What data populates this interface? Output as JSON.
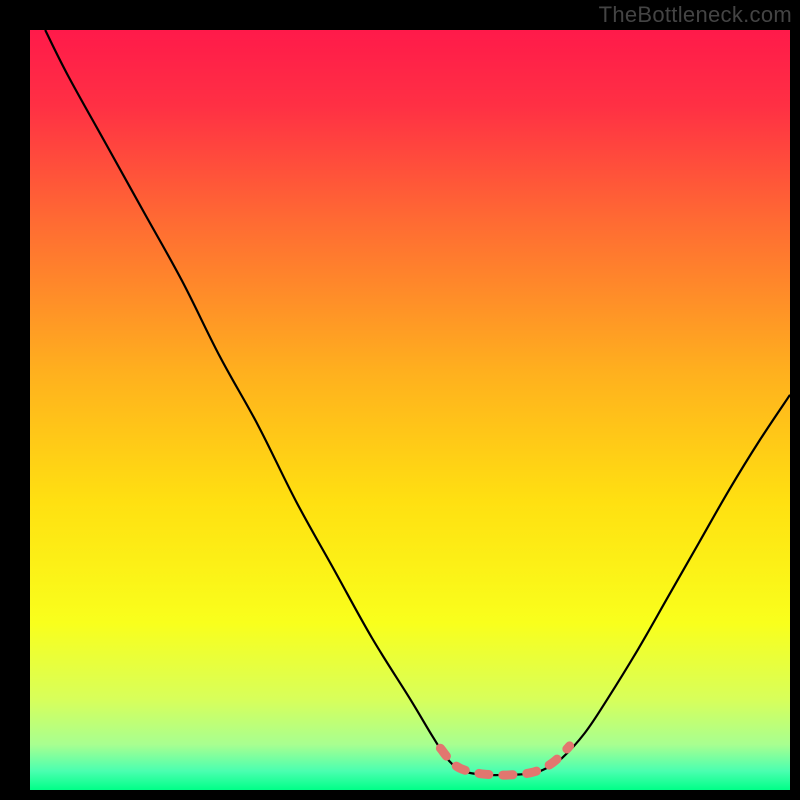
{
  "watermark": "TheBottleneck.com",
  "chart_data": {
    "type": "line",
    "title": "",
    "xlabel": "",
    "ylabel": "",
    "xlim": [
      0,
      100
    ],
    "ylim": [
      0,
      100
    ],
    "grid": false,
    "legend": false,
    "background_gradient_stops": [
      {
        "offset": 0.0,
        "color": "#ff1a4a"
      },
      {
        "offset": 0.1,
        "color": "#ff3044"
      },
      {
        "offset": 0.25,
        "color": "#ff6a33"
      },
      {
        "offset": 0.45,
        "color": "#ffb01e"
      },
      {
        "offset": 0.62,
        "color": "#ffe011"
      },
      {
        "offset": 0.78,
        "color": "#f9ff1c"
      },
      {
        "offset": 0.88,
        "color": "#d8ff5a"
      },
      {
        "offset": 0.94,
        "color": "#a8ff90"
      },
      {
        "offset": 0.975,
        "color": "#4bffb0"
      },
      {
        "offset": 1.0,
        "color": "#00ff88"
      }
    ],
    "series": [
      {
        "name": "bottleneck-curve",
        "stroke": "#000000",
        "points": [
          {
            "x": 2.0,
            "y": 100.0
          },
          {
            "x": 5.0,
            "y": 94.0
          },
          {
            "x": 10.0,
            "y": 85.0
          },
          {
            "x": 15.0,
            "y": 76.0
          },
          {
            "x": 20.0,
            "y": 67.0
          },
          {
            "x": 25.0,
            "y": 57.0
          },
          {
            "x": 30.0,
            "y": 48.0
          },
          {
            "x": 35.0,
            "y": 38.0
          },
          {
            "x": 40.0,
            "y": 29.0
          },
          {
            "x": 45.0,
            "y": 20.0
          },
          {
            "x": 50.0,
            "y": 12.0
          },
          {
            "x": 53.0,
            "y": 7.0
          },
          {
            "x": 55.0,
            "y": 4.0
          },
          {
            "x": 57.0,
            "y": 2.5
          },
          {
            "x": 60.0,
            "y": 2.0
          },
          {
            "x": 63.0,
            "y": 2.0
          },
          {
            "x": 66.0,
            "y": 2.2
          },
          {
            "x": 68.0,
            "y": 2.9
          },
          {
            "x": 70.0,
            "y": 4.2
          },
          {
            "x": 73.0,
            "y": 7.5
          },
          {
            "x": 76.0,
            "y": 12.0
          },
          {
            "x": 80.0,
            "y": 18.5
          },
          {
            "x": 84.0,
            "y": 25.5
          },
          {
            "x": 88.0,
            "y": 32.5
          },
          {
            "x": 92.0,
            "y": 39.5
          },
          {
            "x": 96.0,
            "y": 46.0
          },
          {
            "x": 100.0,
            "y": 52.0
          }
        ]
      },
      {
        "name": "sweet-spot-marker",
        "stroke": "#e2766f",
        "dashed": true,
        "stroke_width": 9,
        "points": [
          {
            "x": 54.0,
            "y": 5.5
          },
          {
            "x": 56.0,
            "y": 3.2
          },
          {
            "x": 58.5,
            "y": 2.3
          },
          {
            "x": 61.0,
            "y": 2.0
          },
          {
            "x": 63.5,
            "y": 2.0
          },
          {
            "x": 66.0,
            "y": 2.3
          },
          {
            "x": 68.0,
            "y": 3.1
          },
          {
            "x": 69.5,
            "y": 4.2
          },
          {
            "x": 71.0,
            "y": 5.8
          }
        ]
      }
    ]
  }
}
